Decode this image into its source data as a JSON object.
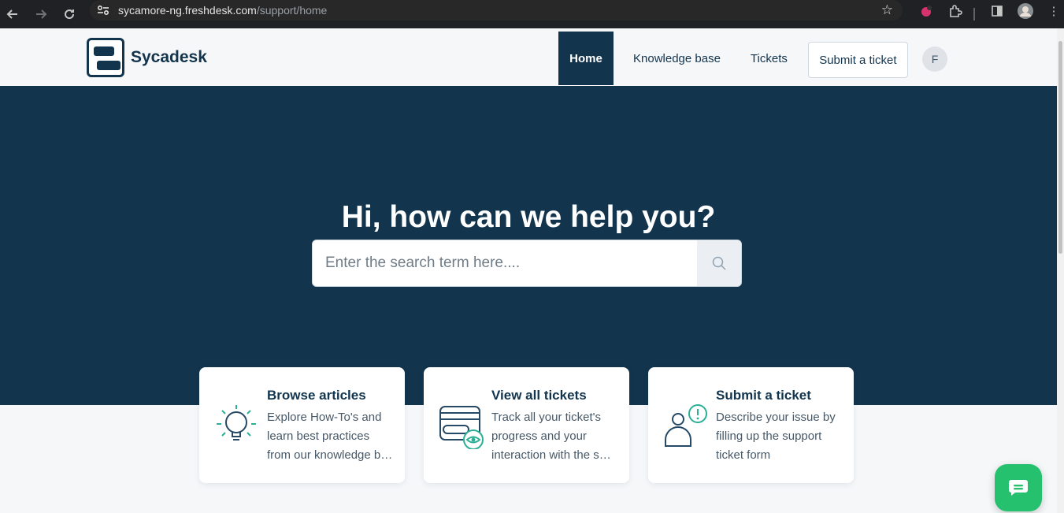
{
  "browser": {
    "url_host": "sycamore-ng.freshdesk.com",
    "url_path": "/support/home"
  },
  "header": {
    "brand": "Sycadesk",
    "nav": {
      "home": "Home",
      "knowledge_base": "Knowledge base",
      "tickets": "Tickets",
      "submit": "Submit a ticket"
    },
    "avatar_initial": "F"
  },
  "hero": {
    "title": "Hi, how can we help you?",
    "search_placeholder": "Enter the search term here...."
  },
  "cards": [
    {
      "title": "Browse articles",
      "desc_lines": [
        "Explore How-To's and",
        "learn best practices",
        "from our knowledge base"
      ],
      "icon": "lightbulb-icon"
    },
    {
      "title": "View all tickets",
      "desc_lines": [
        "Track all your ticket's",
        "progress and your",
        "interaction with the support team"
      ],
      "icon": "tickets-view-icon"
    },
    {
      "title": "Submit a ticket",
      "desc_lines": [
        "Describe your issue by",
        "filling up the support",
        "ticket form"
      ],
      "icon": "user-alert-icon"
    }
  ],
  "colors": {
    "brand": "#12344d",
    "accent": "#2bb097",
    "chat": "#25c16f"
  }
}
